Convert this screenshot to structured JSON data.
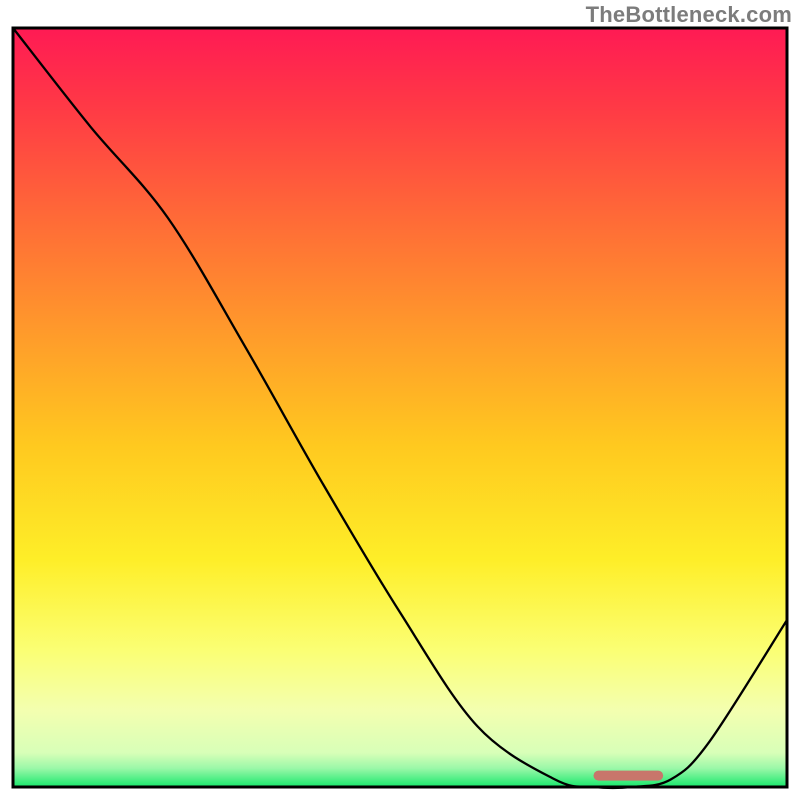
{
  "watermark": "TheBottleneck.com",
  "chart_data": {
    "type": "line",
    "title": "",
    "xlabel": "",
    "ylabel": "",
    "xlim": [
      0,
      100
    ],
    "ylim": [
      0,
      100
    ],
    "grid": false,
    "legend": false,
    "notes": "No axis labels or tick labels are visible in the image. X and Y values are estimated proportionally from the plotted curve against the chart extent (treated as 0–100 on each axis).",
    "series": [
      {
        "name": "curve",
        "x": [
          0,
          10,
          20,
          30,
          40,
          50,
          60,
          70,
          75,
          80,
          85,
          90,
          100
        ],
        "y": [
          100,
          87,
          75,
          58,
          40,
          23,
          8,
          1,
          0,
          0,
          1,
          6,
          22
        ]
      }
    ],
    "annotations": [
      {
        "name": "min-marker",
        "type": "segment",
        "x0": 75,
        "x1": 84,
        "y": 1.5,
        "color": "#c8766b"
      }
    ],
    "axes": {
      "method": "proportional estimate (0–100)",
      "frame": true,
      "frame_color": "#000000"
    },
    "gradient_stops": [
      {
        "pos": 0.0,
        "color": "#ff1a54"
      },
      {
        "pos": 0.1,
        "color": "#ff3846"
      },
      {
        "pos": 0.25,
        "color": "#ff6a37"
      },
      {
        "pos": 0.4,
        "color": "#ff9a2b"
      },
      {
        "pos": 0.55,
        "color": "#ffc91f"
      },
      {
        "pos": 0.7,
        "color": "#feee28"
      },
      {
        "pos": 0.82,
        "color": "#fbff74"
      },
      {
        "pos": 0.9,
        "color": "#f3ffb0"
      },
      {
        "pos": 0.955,
        "color": "#d8ffb8"
      },
      {
        "pos": 0.975,
        "color": "#9cf8a9"
      },
      {
        "pos": 1.0,
        "color": "#17e86c"
      }
    ]
  }
}
